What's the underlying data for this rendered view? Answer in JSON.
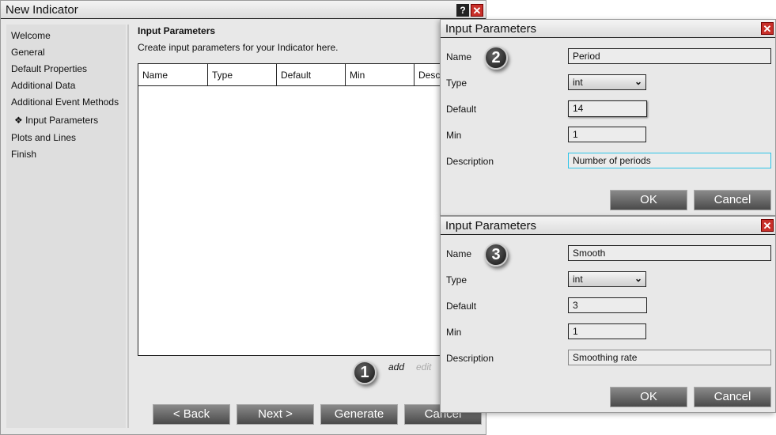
{
  "main_window": {
    "title": "New Indicator",
    "help_icon": "?",
    "close_icon": "✕",
    "sidebar": {
      "items": [
        {
          "label": "Welcome"
        },
        {
          "label": "General"
        },
        {
          "label": "Default Properties"
        },
        {
          "label": "Additional Data"
        },
        {
          "label": "Additional Event Methods"
        },
        {
          "label": "❖ Input Parameters"
        },
        {
          "label": "Plots and Lines"
        },
        {
          "label": "Finish"
        }
      ]
    },
    "heading": "Input Parameters",
    "subheading": "Create input parameters for your Indicator here.",
    "table": {
      "columns": [
        "Name",
        "Type",
        "Default",
        "Min",
        "Desc"
      ]
    },
    "badge": "1",
    "add_label": "add",
    "edit_label": "edit",
    "buttons": {
      "back": "< Back",
      "next": "Next >",
      "generate": "Generate",
      "cancel": "Cancel"
    }
  },
  "dialogs": [
    {
      "title": "Input Parameters",
      "badge": "2",
      "labels": {
        "name": "Name",
        "type": "Type",
        "default": "Default",
        "min": "Min",
        "description": "Description"
      },
      "values": {
        "name": "Period",
        "type": "int",
        "default": "14",
        "min": "1",
        "description": "Number of periods"
      },
      "ok": "OK",
      "cancel": "Cancel"
    },
    {
      "title": "Input Parameters",
      "badge": "3",
      "labels": {
        "name": "Name",
        "type": "Type",
        "default": "Default",
        "min": "Min",
        "description": "Description"
      },
      "values": {
        "name": "Smooth",
        "type": "int",
        "default": "3",
        "min": "1",
        "description": "Smoothing rate"
      },
      "ok": "OK",
      "cancel": "Cancel"
    }
  ],
  "colors": {
    "close": "#c8302a",
    "focus": "#2cc4e8"
  }
}
